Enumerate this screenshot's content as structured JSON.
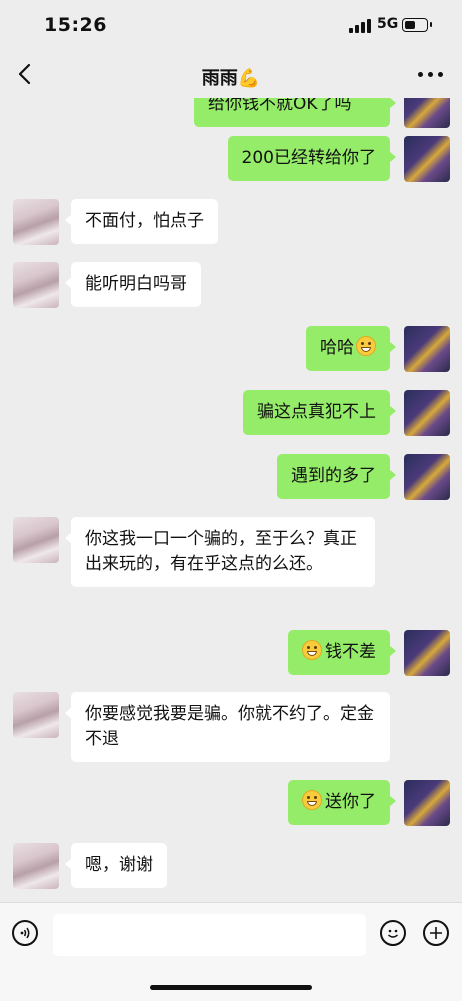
{
  "status_bar": {
    "time": "15:26",
    "network": "5G",
    "battery_level": 0.55
  },
  "header": {
    "title": "雨雨💪"
  },
  "messages": [
    {
      "from": "me",
      "text": "给你钱不就OK了吗"
    },
    {
      "from": "me",
      "text": "200已经转给你了"
    },
    {
      "from": "them",
      "text": "不面付，怕点子"
    },
    {
      "from": "them",
      "text": "能听明白吗哥"
    },
    {
      "from": "me",
      "text": "哈哈",
      "emoji_after": "grinning-face"
    },
    {
      "from": "me",
      "text": "骗这点真犯不上"
    },
    {
      "from": "me",
      "text": "遇到的多了"
    },
    {
      "from": "them",
      "text": "你这我一口一个骗的，至于么？真正出来玩的，有在乎这点的么还。"
    },
    {
      "from": "me",
      "text": "钱不差",
      "emoji_before": "grinning-face"
    },
    {
      "from": "them",
      "text": "你要感觉我要是骗。你就不约了。定金不退"
    },
    {
      "from": "me",
      "text": "送你了",
      "emoji_before": "grimacing-face"
    },
    {
      "from": "them",
      "text": "嗯，谢谢"
    }
  ],
  "input_bar": {
    "placeholder": ""
  },
  "icons": {
    "back": "chevron-left-icon",
    "more": "more-dots-icon",
    "voice": "voice-icon",
    "emoji": "emoji-icon",
    "add": "plus-icon"
  },
  "colors": {
    "background": "#ededed",
    "my_bubble": "#95ec69",
    "their_bubble": "#ffffff"
  }
}
